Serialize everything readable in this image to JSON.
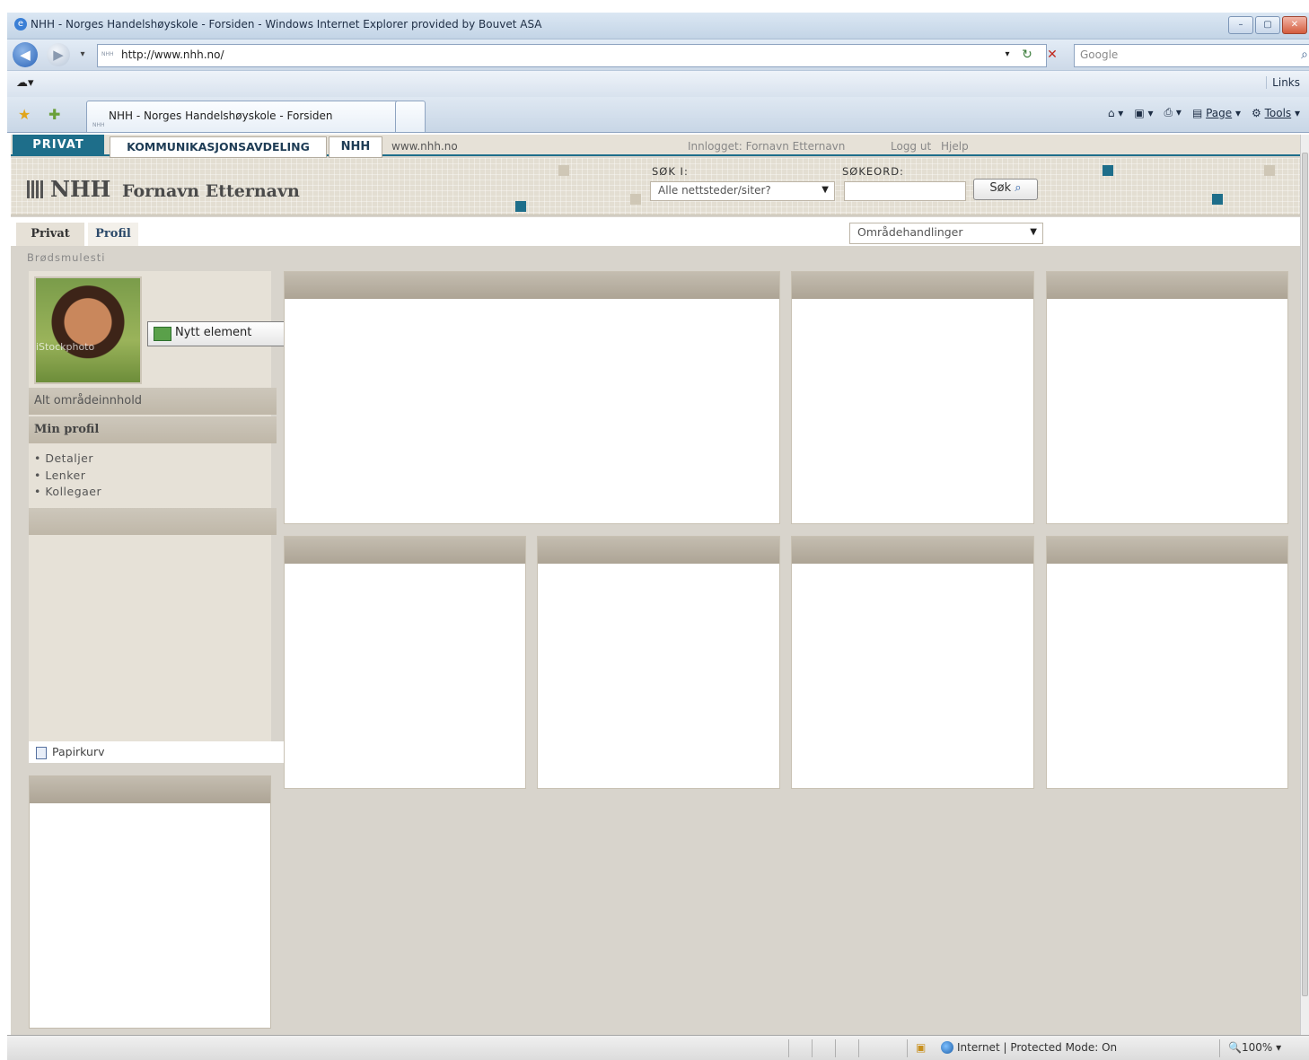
{
  "window": {
    "title": "NHH - Norges Handelshøyskole - Forsiden - Windows Internet Explorer provided by Bouvet ASA",
    "controls": [
      "–",
      "▢",
      "✕"
    ]
  },
  "addressbar": {
    "url": "http://www.nhh.no/",
    "favicon_text": "NHH",
    "search_placeholder": "Google"
  },
  "linksbar": {
    "links_label": "Links"
  },
  "tabs": [
    {
      "label": "NHH - Norges Handelshøyskole - Forsiden",
      "favicon_text": "NHH"
    }
  ],
  "commandbar": {
    "page": "Page",
    "tools": "Tools"
  },
  "topnav": {
    "privat": "PRIVAT",
    "kommunikasjon": "KOMMUNIKASJONSAVDELING",
    "nhh": "NHH",
    "www": "www.nhh.no",
    "logged_in": "Innlogget: Fornavn Etternavn",
    "logout": "Logg ut",
    "help": "Hjelp"
  },
  "banner": {
    "logo": "NHH",
    "site_name": "Fornavn Etternavn",
    "search_in_label": "SØK I:",
    "search_scope": "Alle nettsteder/siter?",
    "keyword_label": "SØKEORD:",
    "keyword_value": "",
    "search_button": "Søk"
  },
  "page_tabs": {
    "privat": "Privat",
    "profil": "Profil"
  },
  "site_actions": "Områdehandlinger",
  "breadcrumb": "Brødsmulesti",
  "left_nav": {
    "photo_caption": "iStockphoto",
    "new_item_button": "Nytt element",
    "all_content": "Alt områdeinnhold",
    "my_profile": "Min profil",
    "profile_links": [
      "Detaljer",
      "Lenker",
      "Kollegaer"
    ],
    "recycle_bin": "Papirkurv"
  },
  "statusbar": {
    "zone": "Internet | Protected Mode: On",
    "zoom": "100%"
  },
  "colors": {
    "accent_teal": "#1e6e8a",
    "page_bg": "#d8d4cc",
    "panel_header": "#b5ad9f"
  }
}
